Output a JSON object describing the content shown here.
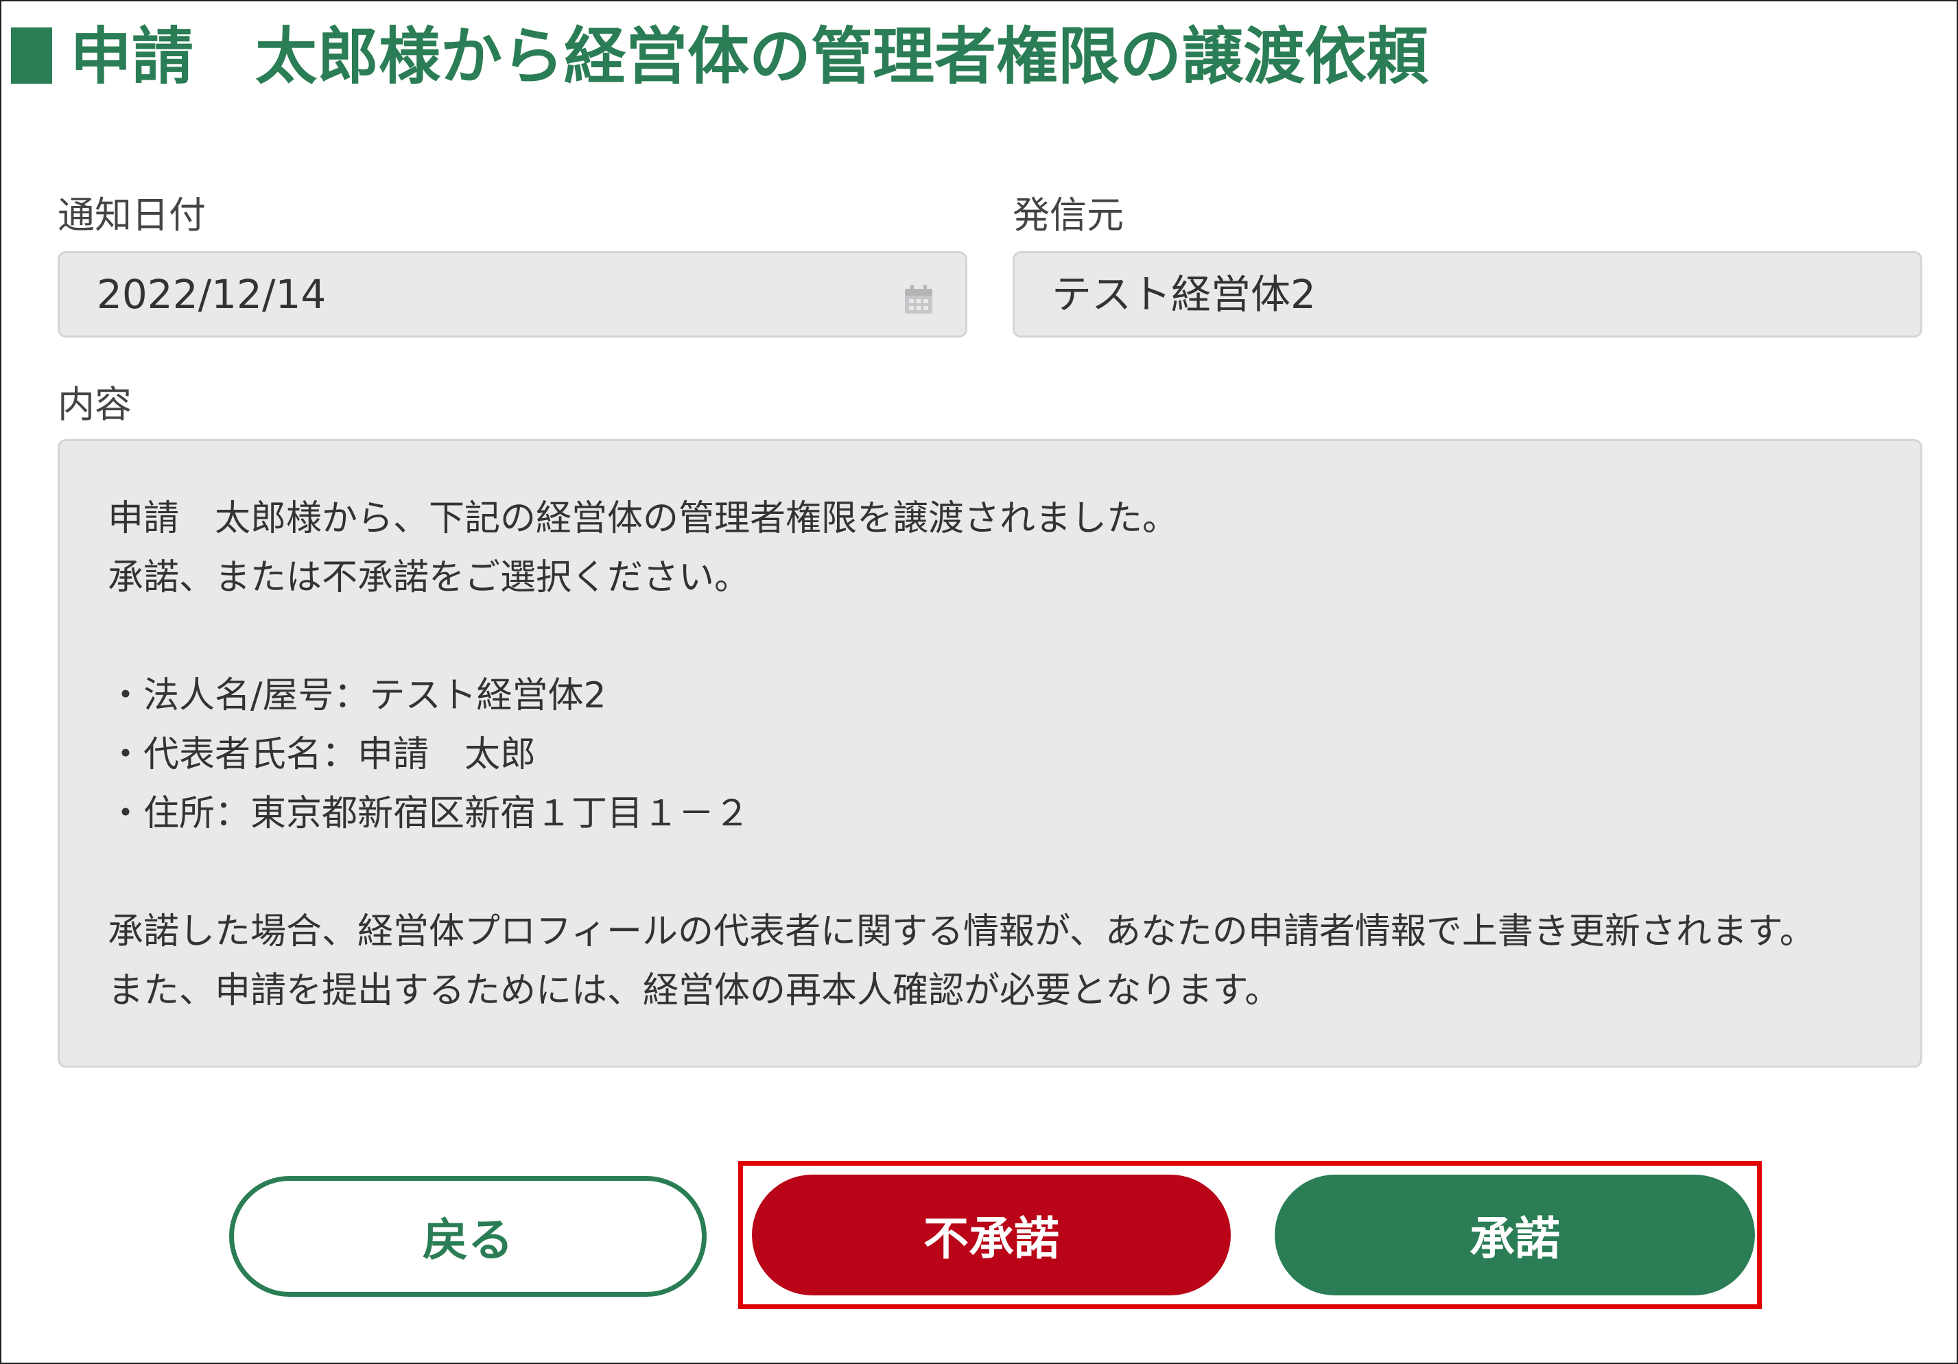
{
  "header": {
    "title": "申請　太郎様から経営体の管理者権限の譲渡依頼"
  },
  "notification_date": {
    "label": "通知日付",
    "value": "2022/12/14",
    "icon": "calendar-icon"
  },
  "sender": {
    "label": "発信元",
    "value": "テスト経営体2"
  },
  "content": {
    "label": "内容",
    "lines": [
      "申請　太郎様から、下記の経営体の管理者権限を譲渡されました。",
      "承諾、または不承諾をご選択ください。",
      "",
      "・法人名/屋号：テスト経営体2",
      "・代表者氏名：申請　太郎",
      "・住所：東京都新宿区新宿１丁目１－２",
      "",
      "承諾した場合、経営体プロフィールの代表者に関する情報が、あなたの申請者情報で上書き更新されます。",
      "また、申請を提出するためには、経営体の再本人確認が必要となります。"
    ]
  },
  "buttons": {
    "back": "戻る",
    "reject": "不承諾",
    "approve": "承諾"
  },
  "colors": {
    "brand_green": "#2a7d54",
    "reject_red": "#b90517",
    "highlight_red": "#e00000",
    "field_bg": "#e8e9ea"
  }
}
